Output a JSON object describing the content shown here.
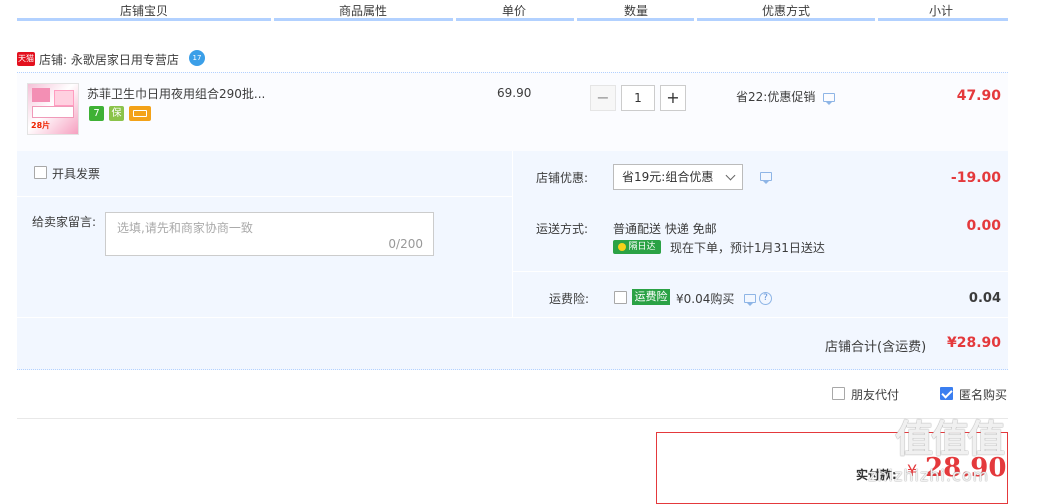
{
  "header": {
    "columns": [
      "店铺宝贝",
      "商品属性",
      "单价",
      "数量",
      "优惠方式",
      "小计"
    ]
  },
  "shop": {
    "badge": "天猫",
    "label": "店铺: 永歌居家日用专营店",
    "ww": "17"
  },
  "item": {
    "title": "苏菲卫生巾日用夜用组合290批...",
    "thumb_text": "28片",
    "services": [
      {
        "name": "seven-day-return-icon",
        "text": "7",
        "color": "#3eb135"
      },
      {
        "name": "guarantee-icon",
        "text": "保",
        "color": "#8bc34a"
      },
      {
        "name": "credit-card-icon",
        "text": "",
        "color": "#f3a218"
      }
    ],
    "unit_price": "69.90",
    "quantity": "1",
    "minus": "−",
    "plus": "+",
    "promo": "省22:优惠促销",
    "subtotal": "47.90"
  },
  "options": {
    "invoice_label": "开具发票",
    "message_label": "给卖家留言:",
    "message_placeholder": "选填,请先和商家协商一致",
    "message_count": "0/200",
    "shop_discount_label": "店铺优惠:",
    "shop_discount_value": "省19元:组合优惠",
    "shop_discount_amount": "-19.00",
    "shipping_label": "运送方式:",
    "shipping_value": "普通配送 快递 免邮",
    "shipping_badge": "隔日达",
    "shipping_eta": "现在下单，预计1月31日送达",
    "shipping_amount": "0.00",
    "insurance_label": "运费险:",
    "insurance_badge": "运费险",
    "insurance_text": "¥0.04购买",
    "insurance_amount": "0.04",
    "shop_total_label": "店铺合计(含运费)",
    "shop_total_amount": "¥28.90"
  },
  "extras": {
    "friend_pay_label": "朋友代付",
    "anonymous_label": "匿名购买",
    "anonymous_checked": true
  },
  "payment": {
    "label": "实付款:",
    "yen": "¥",
    "amount": "28.90"
  },
  "watermark": {
    "logo": "值值值",
    "url": "zhizhizhi.com"
  }
}
